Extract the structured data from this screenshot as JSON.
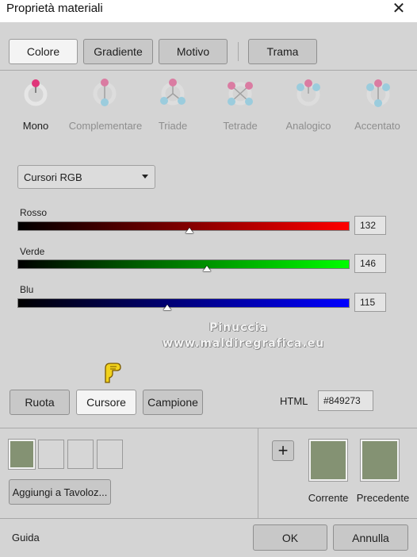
{
  "window": {
    "title": "Proprietà materiali"
  },
  "tabs": [
    "Colore",
    "Gradiente",
    "Motivo",
    "Trama"
  ],
  "harmony": {
    "items": [
      "Mono",
      "Complementare",
      "Triade",
      "Tetrade",
      "Analogico",
      "Accentato"
    ],
    "selected": "Mono"
  },
  "mode_select": {
    "value": "Cursori RGB"
  },
  "sliders": [
    {
      "label": "Rosso",
      "value": "132",
      "level": 132,
      "color": "#ff0000"
    },
    {
      "label": "Verde",
      "value": "146",
      "level": 146,
      "color": "#00ff00"
    },
    {
      "label": "Blu",
      "value": "115",
      "level": 115,
      "color": "#0000ff"
    }
  ],
  "watermark": {
    "line1": "Pinuccia",
    "line2": "www.maldiregrafica.eu"
  },
  "view_buttons": [
    "Ruota",
    "Cursore",
    "Campione"
  ],
  "html_field": {
    "label": "HTML",
    "value": "#849273"
  },
  "add_palette_button": "Aggiungi a Tavoloz...",
  "current_color": "#849273",
  "previous_color": "#849273",
  "swatch_labels": {
    "current": "Corrente",
    "previous": "Precedente"
  },
  "footer": {
    "help": "Guida",
    "ok": "OK",
    "cancel": "Annulla"
  },
  "colors": {
    "pink": "#e0367a",
    "blue": "#6ec6e6",
    "bg": "#d4d4d4"
  }
}
